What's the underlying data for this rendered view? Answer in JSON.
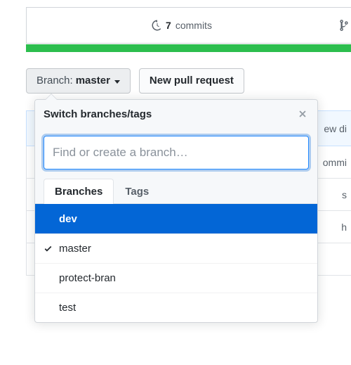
{
  "stats": {
    "commits_count": "7",
    "commits_label": "commits"
  },
  "toolbar": {
    "branch_prefix": "Branch: ",
    "branch_name": "master",
    "new_pr_label": "New pull request"
  },
  "dropdown": {
    "title": "Switch branches/tags",
    "filter_placeholder": "Find or create a branch…",
    "tabs": {
      "branches": "Branches",
      "tags": "Tags"
    },
    "branches": [
      {
        "name": "dev",
        "highlighted": true,
        "current": false
      },
      {
        "name": "master",
        "highlighted": false,
        "current": true
      },
      {
        "name": "protect-bran",
        "highlighted": false,
        "current": false
      },
      {
        "name": "test",
        "highlighted": false,
        "current": false
      }
    ]
  },
  "bg": {
    "header_right": "ew di",
    "rows": [
      "ommi",
      "s",
      "h"
    ]
  }
}
